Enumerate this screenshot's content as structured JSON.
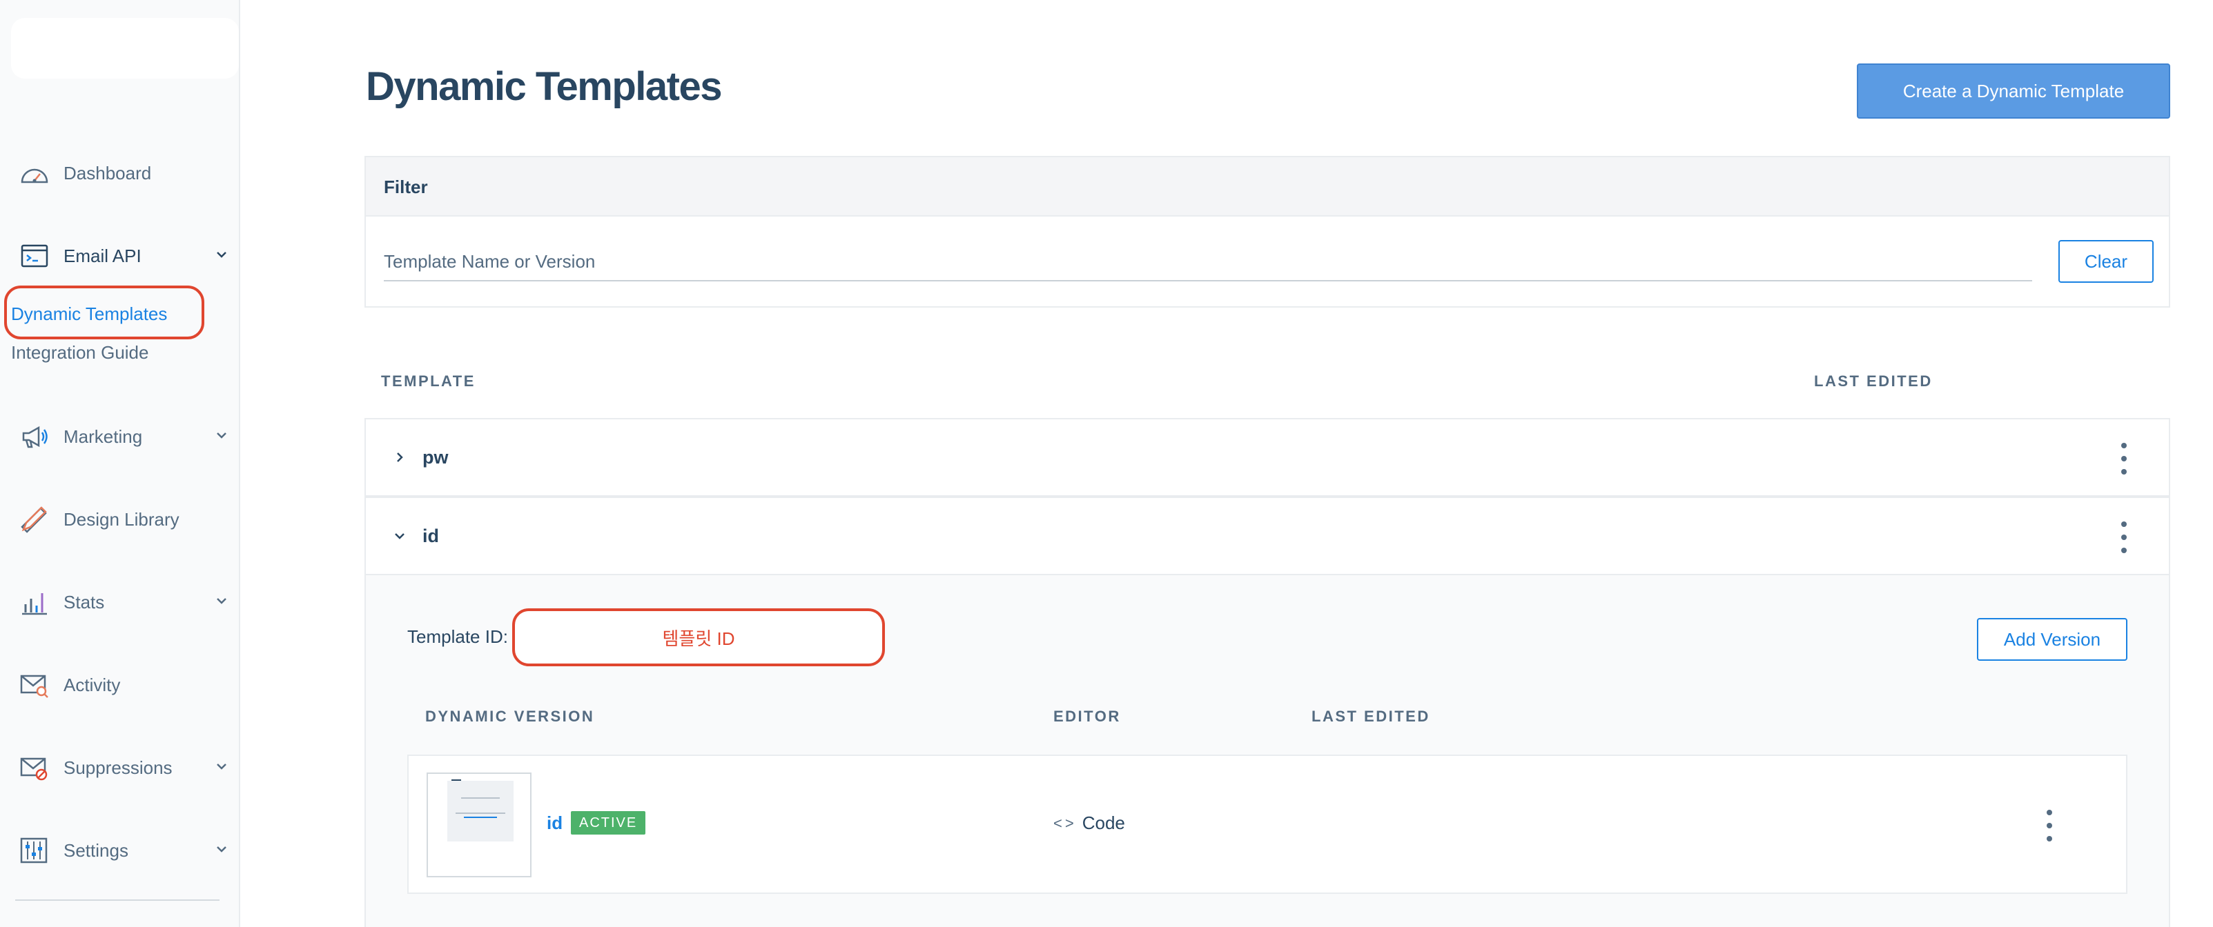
{
  "sidebar": {
    "items": [
      {
        "label": "Dashboard",
        "icon": "dashboard-gauge-icon"
      },
      {
        "label": "Email API",
        "icon": "email-api-terminal-icon",
        "has_chevron": true
      },
      {
        "label": "Marketing",
        "icon": "megaphone-icon",
        "has_chevron": true
      },
      {
        "label": "Design Library",
        "icon": "pencil-ruler-icon"
      },
      {
        "label": "Stats",
        "icon": "bar-chart-icon",
        "has_chevron": true
      },
      {
        "label": "Activity",
        "icon": "envelope-search-icon"
      },
      {
        "label": "Suppressions",
        "icon": "envelope-block-icon",
        "has_chevron": true
      },
      {
        "label": "Settings",
        "icon": "sliders-icon",
        "has_chevron": true
      }
    ],
    "email_api_children": [
      {
        "label": "Dynamic Templates",
        "active": true
      },
      {
        "label": "Integration Guide",
        "active": false
      }
    ]
  },
  "header": {
    "title": "Dynamic Templates",
    "create_button": "Create a Dynamic Template"
  },
  "filter": {
    "title": "Filter",
    "placeholder": "Template Name or Version",
    "value": "",
    "clear_button": "Clear"
  },
  "templates_table": {
    "columns": [
      "TEMPLATE",
      "LAST EDITED"
    ],
    "rows": [
      {
        "name": "pw",
        "expanded": false
      },
      {
        "name": "id",
        "expanded": true
      }
    ]
  },
  "expanded_template": {
    "template_id_label": "Template ID:",
    "template_id_value": "템플릿 ID",
    "add_version_button": "Add Version",
    "version_columns": [
      "DYNAMIC VERSION",
      "EDITOR",
      "LAST EDITED"
    ],
    "versions": [
      {
        "name": "id",
        "status": "ACTIVE",
        "editor": "Code",
        "editor_icon": "code-brackets-icon"
      }
    ]
  },
  "colors": {
    "accent": "#1a82e2",
    "primary_button": "#5b9be3",
    "text": "#294661",
    "muted": "#546b81",
    "highlight": "#e0462f",
    "active_badge": "#4db26a"
  }
}
